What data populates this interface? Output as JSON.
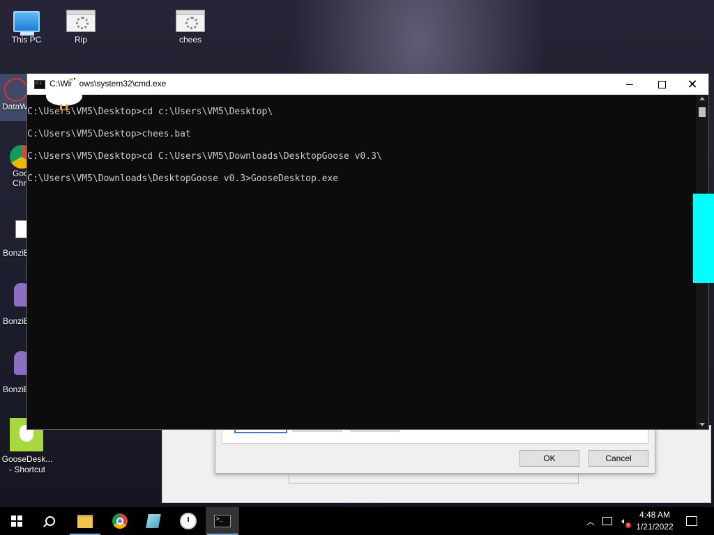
{
  "desktop": {
    "icons": [
      {
        "label": "This PC",
        "icon": "computer-icon"
      },
      {
        "label": "Rip",
        "icon": "batch-file-icon"
      },
      {
        "label": "chees",
        "icon": "batch-file-icon"
      }
    ],
    "side_icons": [
      {
        "label": "DataW",
        "icon": "datawrapper-icon"
      },
      {
        "label": "Goo",
        "label2": "Chro",
        "icon": "chrome-icon"
      },
      {
        "label": "BonziB",
        "icon": "bonzi-icon"
      },
      {
        "label": "BonziB",
        "icon": "bonzi-icon"
      },
      {
        "label": "BonziB",
        "icon": "bonzi-icon"
      },
      {
        "label": "GooseDesk...",
        "label2": "- Shortcut",
        "icon": "goose-icon"
      }
    ]
  },
  "cmd": {
    "title": "C:\\Windows\\system32\\cmd.exe",
    "lines": [
      "C:\\Users\\VM5\\Desktop>cd c:\\Users\\VM5\\Desktop\\",
      "C:\\Users\\VM5\\Desktop>chees.bat",
      "C:\\Users\\VM5\\Desktop>cd C:\\Users\\VM5\\Downloads\\DesktopGoose v0.3\\",
      "C:\\Users\\VM5\\Downloads\\DesktopGoose v0.3>GooseDesktop.exe"
    ]
  },
  "dialog": {
    "ok_label": "OK",
    "cancel_label": "Cancel"
  },
  "taskbar": {
    "apps": [
      "start-icon",
      "search-icon",
      "file-explorer-icon",
      "chrome-icon",
      "notepad-icon",
      "clock-icon",
      "cmd-icon"
    ],
    "time": "4:48 AM",
    "date": "1/21/2022"
  },
  "colors": {
    "cmd_background": "#0c0c0c",
    "cmd_text": "#cccccc",
    "cyan_block": "#00ffff",
    "taskbar": "#000000"
  }
}
